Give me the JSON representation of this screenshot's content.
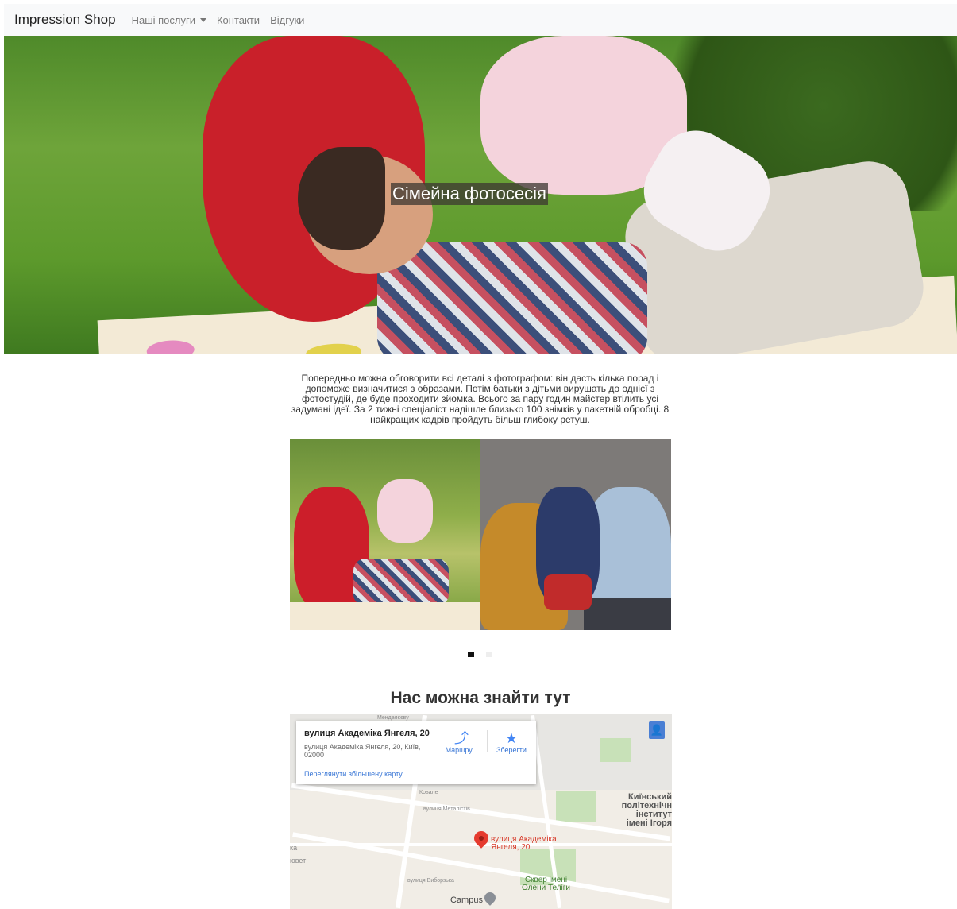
{
  "navbar": {
    "brand": "Impression Shop",
    "links": [
      {
        "label": "Наші послуги",
        "dropdown": true
      },
      {
        "label": "Контакти"
      },
      {
        "label": "Відгуки"
      }
    ]
  },
  "hero": {
    "caption": "Сімейна фотосесія"
  },
  "description": "Попередньо можна обговорити всі деталі з фотографом: він дасть кілька порад і допоможе визначитися з образами. Потім батьки з дітьми вирушать до однієї з фотостудій, де буде проходити зйомка. Всього за пару годин майстер втілить усі задумані ідеї. За 2 тижні спеціаліст надішле близько 100 знімків у пакетній обробці. 8 найкращих кадрів пройдуть більш глибоку ретуш.",
  "carousel": {
    "active_index": 0,
    "count": 2
  },
  "map_section": {
    "title": "Нас можна знайти тут",
    "card": {
      "title": "вулиця Академіка Янгеля, 20",
      "address": "вулиця Академіка Янгеля, 20, Київ, 02000",
      "directions_label": "Маршру...",
      "save_label": "Зберегти",
      "larger_map_link": "Переглянути збільшену карту"
    },
    "labels": {
      "pin": "вулиця Академіка\nЯнгеля, 20",
      "kpi": "Київський\nполітехнічн\nінститут\nімені Ігоря",
      "park": "Сквер імені\nОлени Теліги",
      "campus": "Campus",
      "street1": "вулиця Металістів",
      "street2": "вулиця Виборзька",
      "street3": "Ковале",
      "street4": "Менделєєву",
      "edge1": "ка",
      "edge2": "ювет"
    },
    "colors": {
      "pin": "#e53b2f",
      "link": "#3a77d6"
    }
  },
  "icons": [
    "caret-down-icon",
    "directions-icon",
    "star-icon",
    "pegman-icon",
    "map-pin-icon",
    "campus-pin-icon"
  ]
}
